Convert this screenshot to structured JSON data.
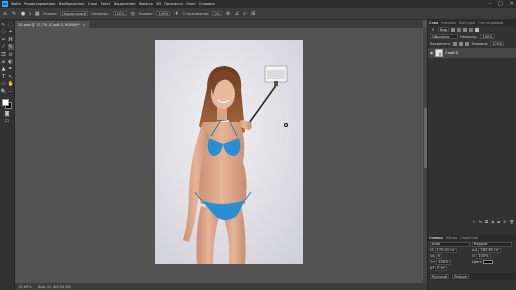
{
  "app": {
    "logo": "Ps"
  },
  "menu": [
    "Файл",
    "Редактирование",
    "Изображение",
    "Слои",
    "Текст",
    "Выделение",
    "Фильтр",
    "3D",
    "Просмотр",
    "Окно",
    "Справка"
  ],
  "window_controls": {
    "minimize": "–",
    "maximize": "□",
    "close": "✕"
  },
  "options": {
    "tool_icon": "pencil-tool-icon",
    "brush_size": "5",
    "mode_label": "Режим:",
    "mode_value": "Нормальный",
    "opacity_label": "Непрозр.:",
    "opacity_value": "100%",
    "flow_label": "Нажим:",
    "flow_value": "100%",
    "smoothing_label": "Сглаживание:",
    "smoothing_value": "0%",
    "angle_value": "0°"
  },
  "document": {
    "tab_title": "20.psd @ 15,7% (Слой 0, RGB/8)*",
    "close": "×"
  },
  "status": {
    "zoom": "15,69%",
    "doc_size": "Док: 51,4М/34,3М"
  },
  "tools": [
    [
      "↖",
      "⬚"
    ],
    [
      "◌",
      "⌖"
    ],
    [
      "✂",
      "⌘"
    ],
    [
      "⁄",
      "✎"
    ],
    [
      "⎄",
      "⊙"
    ],
    [
      "⌀",
      "◐"
    ],
    [
      "▲",
      "✒"
    ],
    [
      "T",
      "↖"
    ],
    [
      "▭",
      "✋"
    ],
    [
      "🔍",
      "⋯"
    ]
  ],
  "layers_panel": {
    "tabs": [
      "Слои",
      "Каналы",
      "Контуры",
      "Гистограмма"
    ],
    "kind_label": "Вид",
    "blend_mode": "Обычные",
    "opacity_label": "Непрозр.:",
    "opacity_value": "100%",
    "lock_label": "Закрепить:",
    "fill_label": "Заливка:",
    "fill_value": "100%",
    "layer_name": "Слой 0"
  },
  "properties_panel": {
    "tabs": [
      "Символ",
      "Абзац",
      "Свойства"
    ],
    "font_label": "Arial",
    "font_style": "Regular",
    "size_value": "175,41 пт",
    "leading_value": "262,61 пт",
    "tracking_label": "VA",
    "tracking_value": "0",
    "scale_v": "100%",
    "scale_h": "100%",
    "baseline": "0 пт",
    "color_label": "Цвет:",
    "lang_value": "Русский",
    "aa_value": "Резкое"
  },
  "colors": {
    "accent": "#31a8ff",
    "swimsuit": "#2a8fd0",
    "background_photo": "#e4e4ea"
  }
}
